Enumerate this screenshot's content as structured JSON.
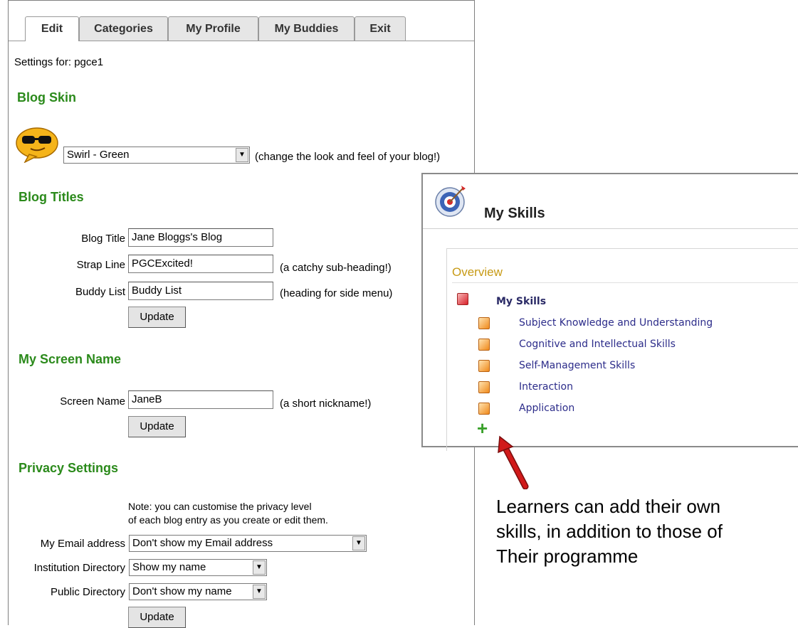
{
  "tabs": [
    "Edit",
    "Categories",
    "My Profile",
    "My Buddies",
    "Exit"
  ],
  "settings_for": "Settings for: pgce1",
  "blog_skin": {
    "heading": "Blog Skin",
    "selected": "Swirl - Green",
    "hint": "(change the look and feel of your blog!)"
  },
  "blog_titles": {
    "heading": "Blog Titles",
    "blog_title_label": "Blog Title",
    "blog_title_value": "Jane Bloggs's Blog",
    "strap_line_label": "Strap Line",
    "strap_line_value": "PGCExcited!",
    "strap_line_hint": "(a catchy sub-heading!)",
    "buddy_list_label": "Buddy List",
    "buddy_list_value": "Buddy List",
    "buddy_list_hint": "(heading for side menu)",
    "update_label": "Update"
  },
  "screen_name": {
    "heading": "My Screen Name",
    "label": "Screen Name",
    "value": "JaneB",
    "hint": "(a short nickname!)",
    "update_label": "Update"
  },
  "privacy": {
    "heading": "Privacy Settings",
    "note_line1": "Note: you can customise the privacy level",
    "note_line2": "of each blog entry as you create or edit them.",
    "email_label": "My Email address",
    "email_value": "Don't show my Email address",
    "institution_label": "Institution Directory",
    "institution_value": "Show my name",
    "public_label": "Public Directory",
    "public_value": "Don't show my name",
    "update_label": "Update"
  },
  "skills_panel": {
    "title": "My Skills",
    "overview": "Overview",
    "root": "My Skills",
    "items": [
      "Subject Knowledge and Understanding",
      "Cognitive and Intellectual Skills",
      "Self-Management Skills",
      "Interaction",
      "Application"
    ],
    "add_symbol": "+"
  },
  "annotation": {
    "line1": "Learners can add their own",
    "line2": "skills, in addition to those of",
    "line3": "Their programme"
  },
  "colors": {
    "heading": "#2b8a1b",
    "skill_link": "#2c2c8a",
    "overview": "#c79a15",
    "arrow": "#d11a1a"
  }
}
